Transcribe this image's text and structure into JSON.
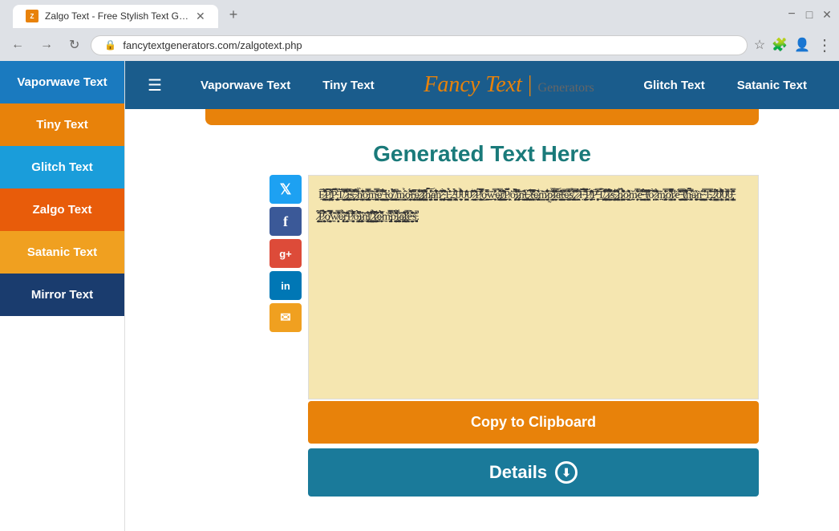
{
  "browser": {
    "tab_title": "Zalgo Text - Free Stylish Text Gen...",
    "tab_favicon": "Z",
    "url": "fancytextgenerators.com/zalgotext.php",
    "new_tab_icon": "+"
  },
  "nav": {
    "hamburger_icon": "☰",
    "vaporwave_label": "Vaporwave Text",
    "tiny_label": "Tiny Text",
    "logo_fancy": "Fancy",
    "logo_text": "Text",
    "logo_separator": "|",
    "logo_gen": "Generators",
    "glitch_label": "Glitch Text",
    "satanic_label": "Satanic Text"
  },
  "sidebar": {
    "items": [
      {
        "id": "vaporwave",
        "label": "Vaporwave Text",
        "class": "vaporwave-text"
      },
      {
        "id": "tiny",
        "label": "Tiny Text",
        "class": "tiny"
      },
      {
        "id": "glitch",
        "label": "Glitch Text",
        "class": "glitch"
      },
      {
        "id": "zalgo",
        "label": "Zalgo Text",
        "class": "zalgo"
      },
      {
        "id": "satanic",
        "label": "Satanic Text",
        "class": "satanic"
      },
      {
        "id": "mirror",
        "label": "Mirror Text",
        "class": "mirror"
      }
    ]
  },
  "content": {
    "generated_title": "Generated Text Here",
    "zalgo_content": "F̶̧̺̖̩͍͖̫̯̙̖̺̳͍͑̅͛͌̅̓̽̏̉̒P̷͔̬̦͔̺͓̫̩͍̯͍̻̊̋̓̒̿̒̾͑͋͝P̸͚̤̅̈́͆̓̈T̵̢͙͕͚̬͍̼͎͕̝̟̩̓̑̾͗ ̷̧̛̟̤̬͎̙̺̦͉̙͔̳͚͋̉̇͗̾ͅî̶͓̗͍͉͇͎̥̙͑̏̿͜s̸͉̦͖̣̱̥̈́̌̊̏̕ ̵̬͎̭̤̈́̇̾̋͋͒̇͗̈́͝h̸̨̡͉̻̜̺̲̪̰̖̐̎̄̄̈́o̷̯͇͙̼̳̗̳̅̄̃̐̈́̃̏͝m̶͖̗̙͉͚̬̘͈̓̓̏͆̈̑̍̊ͅẽ̴̡̬͚̞͚͖̼͍̺̫̣̤̤̏̓͗̈̿̃̚͜ ̸̣̺͔̒̎̃t̷̻̖̻͚̤̯̼̥̹̫͔͙͌́͒̄̓̍͒̌̏̚͝ő̵̢̦̺̜͇̙͇̺̻̗̈́̂͌̓̃ͅ ̵̛̳̗͔̙͔͓͚͕͖̲̺̩̾̎͑̅̄́̃͜m̷̲͚̹̩̳̱̠͚̣̩̈́̐̈́͛͑̊̊͝o̶̧̧͚̝̻̱̙͍̹͇̜̺͒̊͐͌́̂͆̒̓̄̽̑͘r̸̡̞̤̜͉͚͔͙̺͑̎͗͑̔̅̅͐̅̒͝e̴̲̠͑̿̒̚ ̸̛̜̱̫̹̈̐̍̃̊t̶̛͔͕͕͍̹͎͈̳̤̞̍̉͛̓̓̎͗͜ḩ̷̧̛̠͙̮̟͎͕͙̖̞̻̑͑͊̎̌͂̚̚͝ā̴̗̜̹̙͙̯̺͍͎̫̂̈̄̑̌̓͂̅͠͝n̷̡̗͉̤̯̙̟̋͐̅͐́̒̃͆̽̕ ̶̝̖̲̯̘̈́̿͋̏̑̂͋̉̇̚1̸̡͓̖͙͕̣̩̆̄͌͑̐̑̓͝2̷̨̗̻̠̪̝̦̑̃̽̈́̂͘0̷͍̤͉͈̩̽͐̈́̉̍0̷̮͔͚̣̩̠̝̃͆̒̅̚0̷̩̪̙̺̞̬̰̫̫͑̇̈́̀̽̾̎ ̸̨͚̬̠͉̓͒̌͒͑̂͒͋̎̚P̶̡̙̙̹͚̬̤̪̱̓̅̊̇̾̃ö̶̘̠̪͎̈́͌͛̔͛w̵̻̩̖̞͈͓͓̥̯̙͊̌̏̿̓ḛ̴̤̬̗̪͕͕̤̲̪͙̀̒̍r̵͕̰̣̟̮̮̻̍͌͋̍̔̈̋͑͜Ṗ̸̬̥̰̜̱̠̦̥̲̲̌͆̌́̑̈́̿̈́͋̒̈ơ̴͍̤̠̻̮̗͑͐̋͗̈́̾̆̆̿͘i̵̳͚̥̬̮̻̒̂͆̋̉͠ǹ̸̢̤̻͍̱̦̺̅̐̔̽̑̿̋̉͒͜ẗ̷̲͕̹̯͇͇́̈́̀͊̆ ̸̤̹̝͕͙̠̹̾̽̌̎̌t̴͚̪̣̗̱̳̹̱͔̫͇̅͆ȇ̵̦̘͕͍̗͈̜̦̳̄͑͐̔̂̕͠m̶̯̳͈̙͆̄͗̌̚͝͝p̶̨͍̘̦̺̝̗͙̥̩̜̯͐̐̅͐͌̑̈́͋̐̉͘l̷̡̪͔̳̫̰̭͖̣̓̽̈́͒̽̑̔̏̕̕͝͠a̷̛̪͇̬͇̗̣̬̗͈̼̖̎̓̾̑̂t̷̼̝̯̯̗̿͌͋̎̇͗e̶̞̗̳̩̫̳͉̊̒̀ͅs̵͓̝̖̜̰͓͓̉̄͆̓̊͆̿̽̾.",
    "copy_label": "Copy to Clipboard",
    "details_label": "Details",
    "details_icon": "⬇"
  },
  "social": {
    "twitter_icon": "🐦",
    "facebook_icon": "f",
    "google_icon": "g+",
    "linkedin_icon": "in",
    "email_icon": "✉"
  },
  "colors": {
    "nav_bg": "#1a5c8c",
    "logo_color": "#e8820a",
    "orange_btn": "#e8820a",
    "teal_btn": "#1a7a9a",
    "output_bg": "#f5e6b0",
    "title_color": "#1a7a7a"
  }
}
